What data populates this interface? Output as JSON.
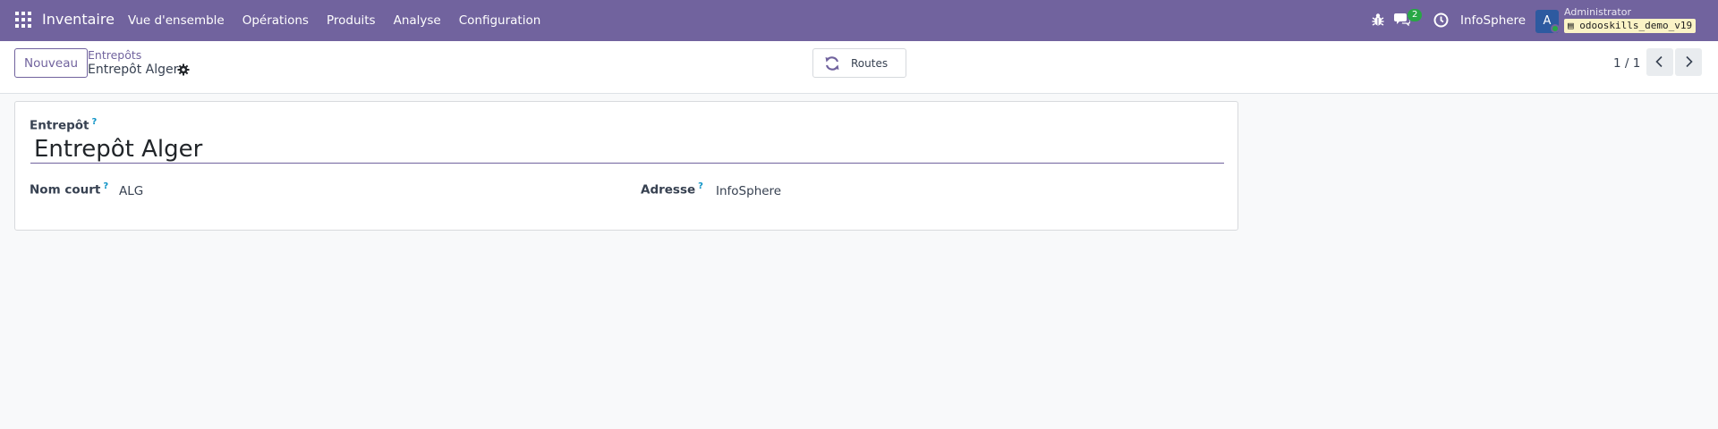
{
  "navbar": {
    "app_name": "Inventaire",
    "menu": [
      "Vue d'ensemble",
      "Opérations",
      "Produits",
      "Analyse",
      "Configuration"
    ],
    "chat_count": "2",
    "company": "InfoSphere",
    "avatar_letter": "A",
    "user_name": "Administrator",
    "database": "odooskills_demo_v19",
    "accent_color": "#71639e"
  },
  "control": {
    "new_label": "Nouveau",
    "breadcrumb": "Entrepôts",
    "record_title": "Entrepôt Alger",
    "routes_label": "Routes",
    "pager": "1 / 1"
  },
  "form": {
    "warehouse_label": "Entrepôt",
    "warehouse_name": "Entrepôt Alger",
    "short_name_label": "Nom court",
    "short_name": "ALG",
    "address_label": "Adresse",
    "address": "InfoSphere",
    "help_mark": "?"
  }
}
